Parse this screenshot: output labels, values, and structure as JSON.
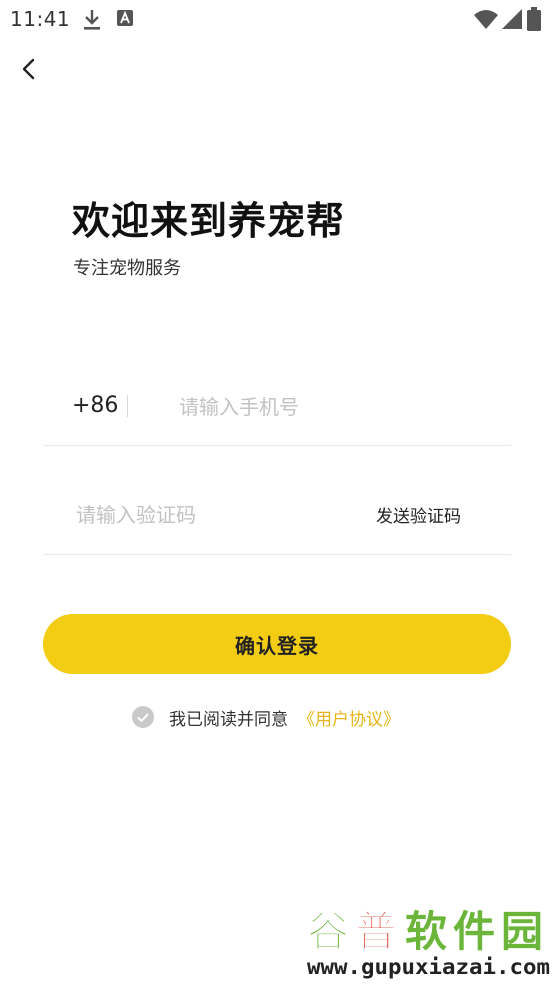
{
  "status_bar": {
    "time": "11:41",
    "icons": [
      "download-icon",
      "a-icon",
      "wifi-icon",
      "signal-icon",
      "battery-icon"
    ]
  },
  "header": {
    "back_icon": "chevron-left-icon"
  },
  "welcome": {
    "title": "欢迎来到养宠帮",
    "subtitle": "专注宠物服务"
  },
  "form": {
    "country_code": "+86",
    "phone_placeholder": "请输入手机号",
    "phone_value": "",
    "code_placeholder": "请输入验证码",
    "code_value": "",
    "send_code_label": "发送验证码",
    "login_label": "确认登录"
  },
  "agreement": {
    "checked": true,
    "text": "我已阅读并同意",
    "link": "《用户协议》"
  },
  "watermark": {
    "brand": "谷普软件园",
    "url": "www.gupuxiazai.com"
  },
  "colors": {
    "accent": "#f3cc14",
    "link": "#e6b417",
    "checkbox": "#c9c9c9",
    "watermark_green": "#6bb53a",
    "watermark_red": "#d92b1e"
  }
}
